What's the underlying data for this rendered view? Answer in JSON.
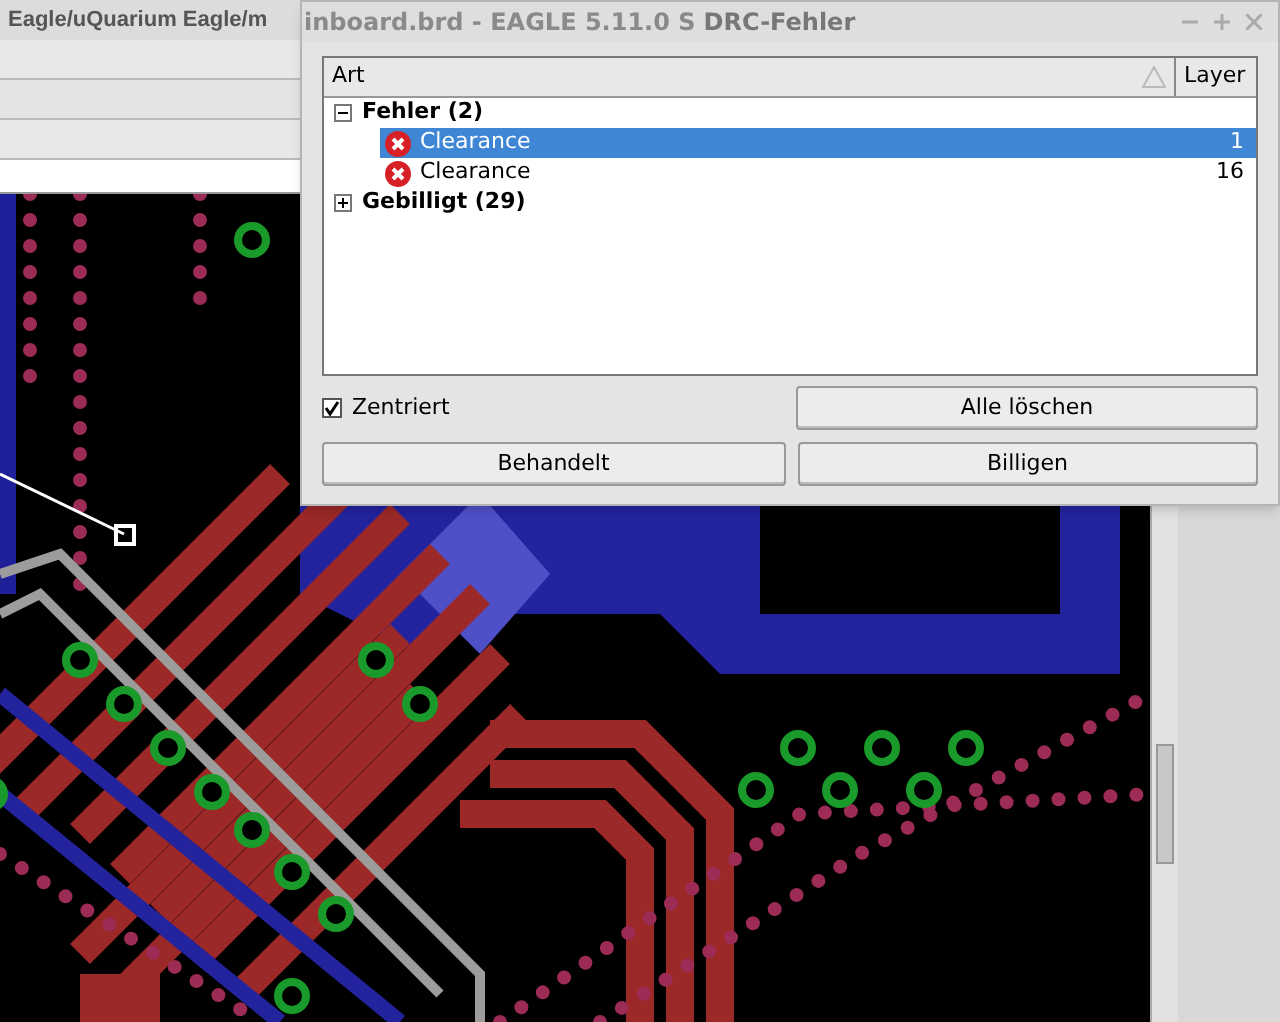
{
  "main_window": {
    "title": "Eagle/uQuarium Eagle/m",
    "title_behind_dialog": "inboard.brd - EAGLE 5.11.0 S"
  },
  "dialog": {
    "title": "DRC-Fehler",
    "columns": [
      "Art",
      "Layer"
    ],
    "tree": [
      {
        "label": "Fehler (2)",
        "expanded": true,
        "children": [
          {
            "label": "Clearance",
            "layer": "1",
            "selected": true
          },
          {
            "label": "Clearance",
            "layer": "16",
            "selected": false
          }
        ]
      },
      {
        "label": "Gebilligt (29)",
        "expanded": false
      }
    ],
    "checkbox": {
      "label": "Zentriert",
      "checked": true
    },
    "buttons": [
      "Alle löschen",
      "Behandelt",
      "Billigen"
    ]
  }
}
